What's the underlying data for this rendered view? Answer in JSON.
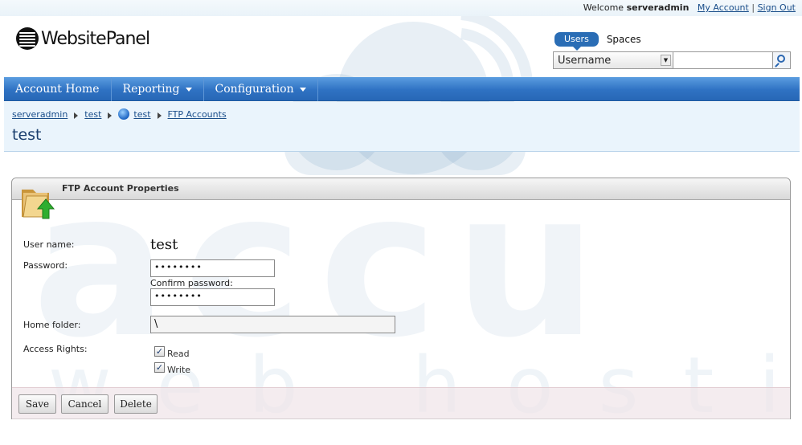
{
  "header": {
    "welcome_text": "Welcome",
    "username": "serveradmin",
    "my_account": "My Account",
    "separator": "|",
    "sign_out": "Sign Out"
  },
  "logo": {
    "text": "WebsitePanel"
  },
  "search": {
    "tab_users": "Users",
    "tab_spaces": "Spaces",
    "field_selected": "Username",
    "query": "",
    "icon": "search-icon"
  },
  "nav": {
    "items": [
      {
        "label": "Account Home",
        "has_dropdown": false
      },
      {
        "label": "Reporting",
        "has_dropdown": true
      },
      {
        "label": "Configuration",
        "has_dropdown": true
      }
    ]
  },
  "breadcrumb": {
    "items": [
      "serveradmin",
      "test",
      "test",
      "FTP Accounts"
    ]
  },
  "page": {
    "title": "test"
  },
  "panel": {
    "title": "FTP Account Properties",
    "username_label": "User name:",
    "username_value": "test",
    "password_label": "Password:",
    "password_mask": "••••••••",
    "confirm_label": "Confirm password:",
    "confirm_mask": "••••••••",
    "home_label": "Home folder:",
    "home_value": "\\",
    "rights_label": "Access Rights:",
    "rights": [
      {
        "label": "Read",
        "checked": true
      },
      {
        "label": "Write",
        "checked": true
      }
    ]
  },
  "buttons": {
    "save": "Save",
    "cancel": "Cancel",
    "delete": "Delete"
  },
  "watermark": {
    "line1": "accu",
    "line2": "web hosting"
  },
  "colors": {
    "nav_blue": "#2f72c3",
    "link": "#1a4e8a",
    "title": "#1b3f6e"
  }
}
